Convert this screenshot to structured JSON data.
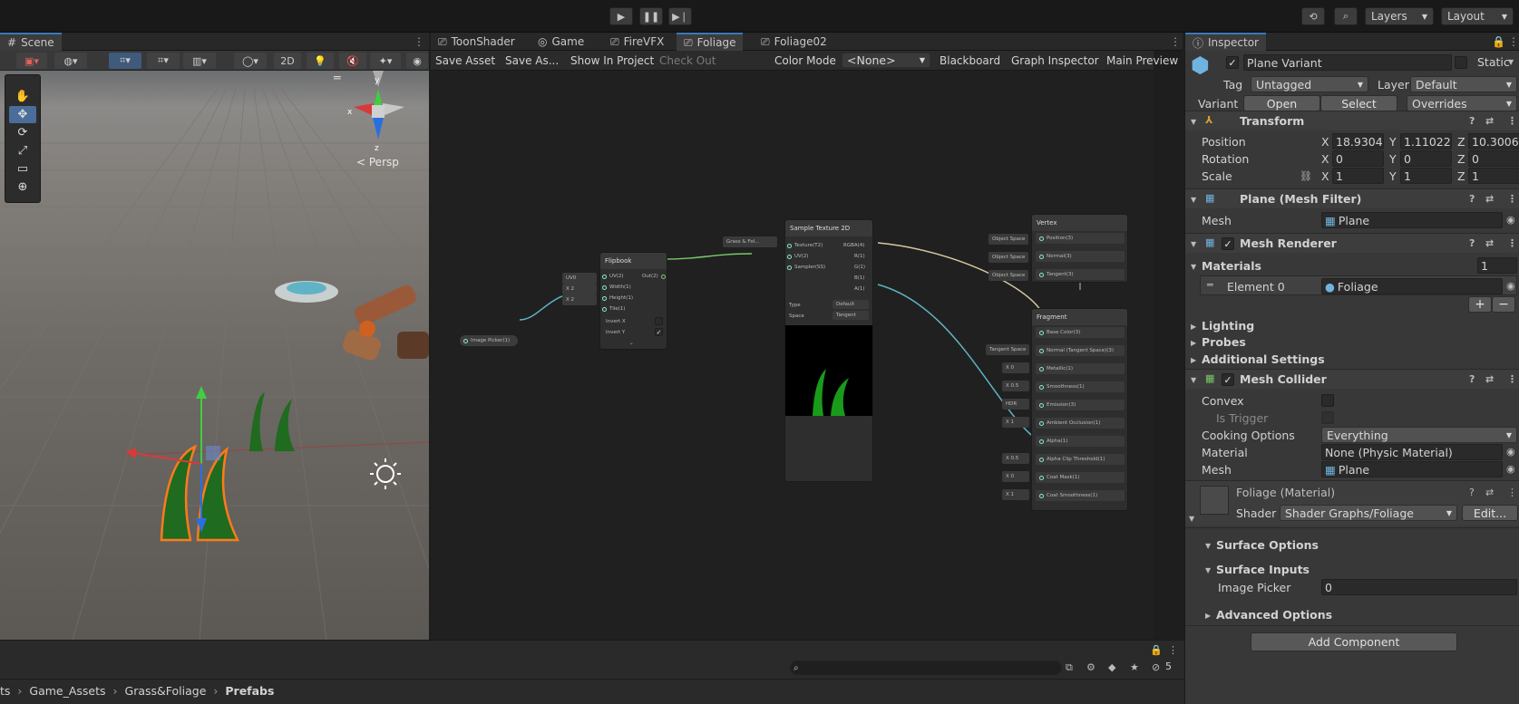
{
  "topbar": {
    "layers": "Layers",
    "layout": "Layout"
  },
  "scene": {
    "tab": "Scene",
    "btn_2d": "2D",
    "persp": "Persp"
  },
  "graph": {
    "tabs": [
      "ToonShader",
      "Game",
      "FireVFX",
      "Foliage",
      "Foliage02"
    ],
    "toolbar": {
      "save": "Save Asset",
      "save_as": "Save As...",
      "show": "Show In Project",
      "checkout": "Check Out",
      "color_mode": "Color Mode",
      "color_value": "<None>",
      "blackboard": "Blackboard",
      "graph_inspector": "Graph Inspector",
      "main_preview": "Main Preview"
    },
    "nodes": {
      "flipbook": {
        "title": "Flipbook",
        "in": [
          "UV(2)",
          "Width(1)",
          "Height(1)",
          "Tile(1)"
        ],
        "out": "Out(2)",
        "uv": "UV0",
        "w": "2",
        "h": "2",
        "invx": "Invert X",
        "invy": "Invert Y"
      },
      "sample": {
        "title": "Sample Texture 2D",
        "in": [
          "Texture(T2)",
          "UV(2)",
          "Sampler(SS)"
        ],
        "out": [
          "RGBA(4)",
          "R(1)",
          "G(1)",
          "B(1)",
          "A(1)"
        ],
        "tex": "Grass & Fol...",
        "type_l": "Type",
        "type_v": "Default",
        "space_l": "Space",
        "space_v": "Tangent"
      },
      "picker": {
        "label": "Image Picker(1)"
      },
      "vertex": {
        "title": "Vertex",
        "ports": [
          "Position(3)",
          "Normal(3)",
          "Tangent(3)"
        ],
        "space": "Object Space"
      },
      "fragment": {
        "title": "Fragment",
        "ports": [
          "Base Color(3)",
          "Normal (Tangent Space)(3)",
          "Metallic(1)",
          "Smoothness(1)",
          "Emission(3)",
          "Ambient Occlusion(1)",
          "Alpha(1)",
          "Alpha Clip Threshold(1)",
          "Coat Mask(1)",
          "Coat Smoothness(1)"
        ],
        "tspace": "Tangent Space",
        "metal": "0",
        "smooth": "0.5",
        "hdr": "HDR",
        "ao": "1",
        "clip": "0.5",
        "coat": "0",
        "coats": "1"
      }
    }
  },
  "inspector": {
    "tab": "Inspector",
    "name": "Plane Variant",
    "static": "Static",
    "tag_l": "Tag",
    "tag_v": "Untagged",
    "layer_l": "Layer",
    "layer_v": "Default",
    "variant_l": "Variant",
    "open": "Open",
    "select": "Select",
    "overrides": "Overrides",
    "transform": {
      "title": "Transform",
      "pos_l": "Position",
      "rot_l": "Rotation",
      "scale_l": "Scale",
      "pos": [
        "18.9304",
        "1.110223",
        "10.3006"
      ],
      "rot": [
        "0",
        "0",
        "0"
      ],
      "scale": [
        "1",
        "1",
        "1"
      ]
    },
    "meshfilter": {
      "title": "Plane (Mesh Filter)",
      "mesh_l": "Mesh",
      "mesh_v": "Plane"
    },
    "renderer": {
      "title": "Mesh Renderer",
      "materials": "Materials",
      "count": "1",
      "el0": "Element 0",
      "el0_v": "Foliage",
      "lighting": "Lighting",
      "probes": "Probes",
      "additional": "Additional Settings"
    },
    "collider": {
      "title": "Mesh Collider",
      "convex": "Convex",
      "trigger": "Is Trigger",
      "cooking_l": "Cooking Options",
      "cooking_v": "Everything",
      "mat_l": "Material",
      "mat_v": "None (Physic Material)",
      "mesh_l": "Mesh",
      "mesh_v": "Plane"
    },
    "material": {
      "title": "Foliage (Material)",
      "shader_l": "Shader",
      "shader_v": "Shader Graphs/Foliage",
      "edit": "Edit...",
      "surface_opts": "Surface Options",
      "surface_inputs": "Surface Inputs",
      "picker_l": "Image Picker",
      "picker_v": "0",
      "advanced": "Advanced Options"
    },
    "add": "Add Component"
  },
  "project": {
    "crumbs": [
      "ts",
      "Game_Assets",
      "Grass&Foliage",
      "Prefabs"
    ],
    "count": "5"
  }
}
